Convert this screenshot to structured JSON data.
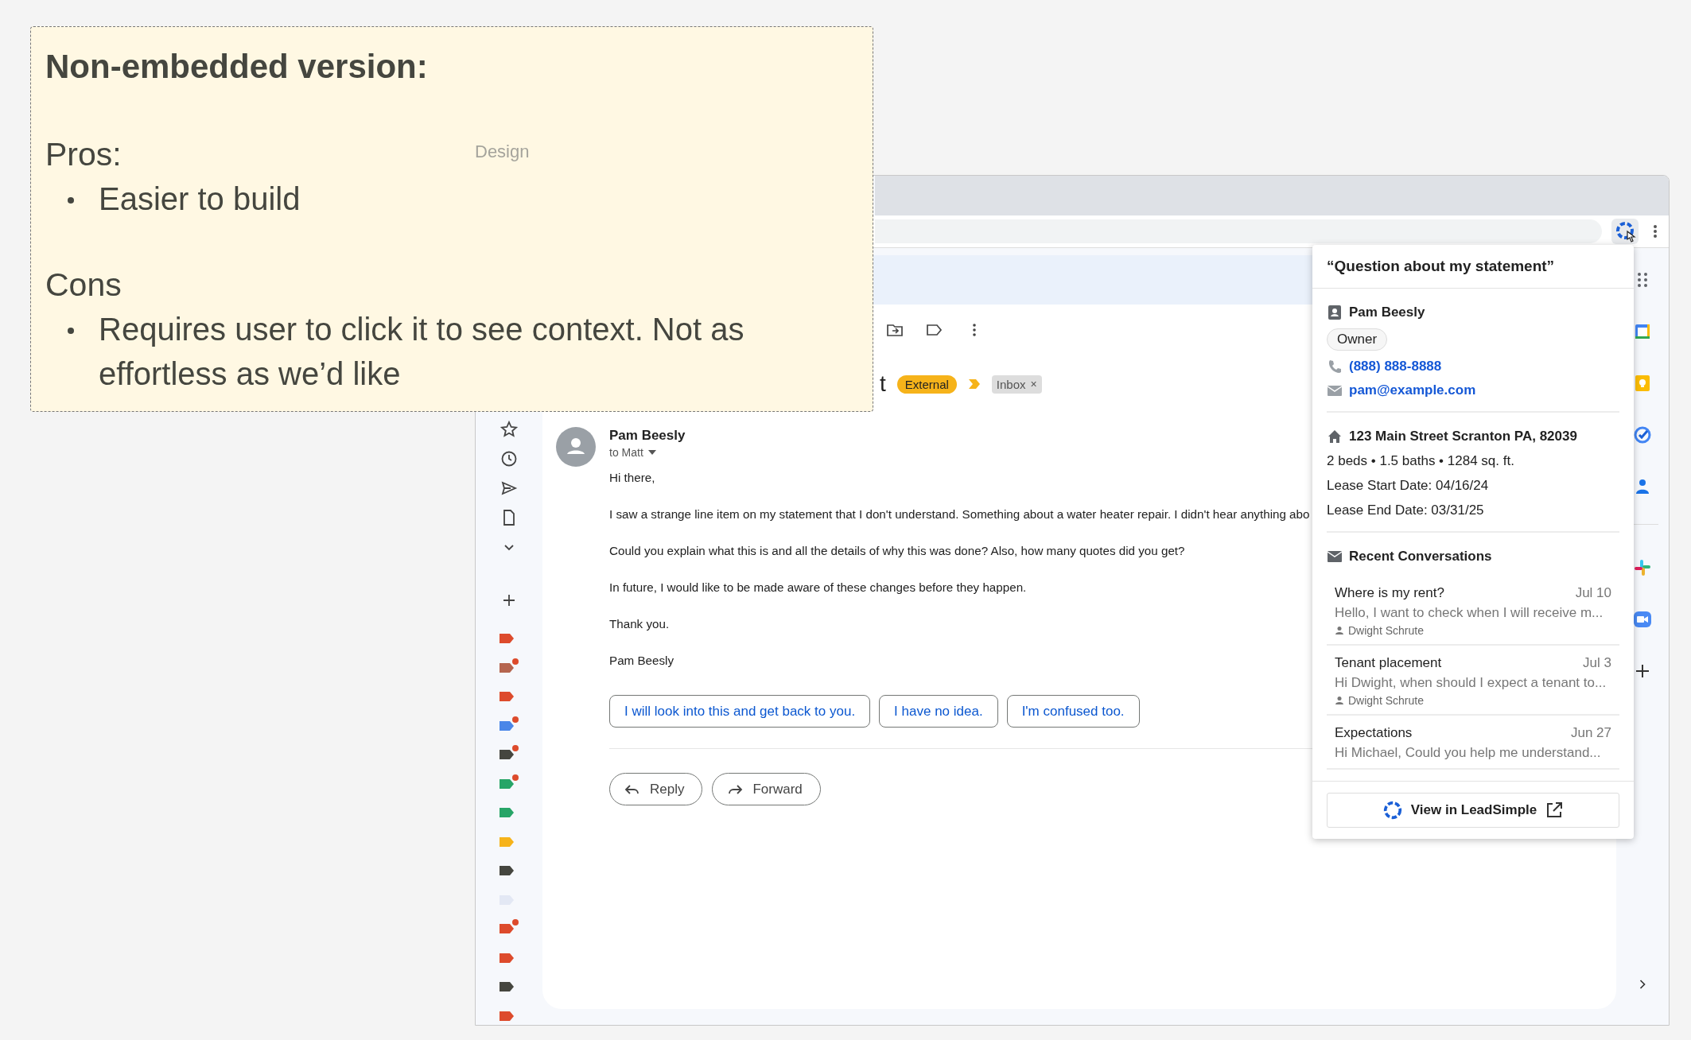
{
  "frame_label": "Design",
  "note": {
    "title": "Non-embedded version:",
    "sections": [
      {
        "heading": "Pros:",
        "items": [
          "Easier to build"
        ]
      },
      {
        "heading": "Cons",
        "items": [
          "Requires user to click it to see context. Not as effortless as we’d like"
        ]
      }
    ]
  },
  "gmail": {
    "subject_fragment": "t",
    "tags": [
      {
        "kind": "chip",
        "label": "External"
      },
      {
        "kind": "removable",
        "label": "Inbox",
        "remove": "×"
      }
    ],
    "message": {
      "sender": "Pam Beesly",
      "recipient": "to Matt",
      "body": [
        "Hi there,",
        "I saw a strange line item on my statement that I don't understand. Something about a water heater repair. I didn't hear anything abo",
        "Could you explain what this is and all the details of why this was done? Also, how many quotes did you get?",
        "In future, I would like to be made aware of these changes before they happen.",
        "Thank you.",
        "Pam Beesly"
      ],
      "smart_replies": [
        "I will look into this and get back to you.",
        "I have no idea.",
        "I'm confused too."
      ],
      "actions": [
        {
          "kind": "reply",
          "label": "Reply"
        },
        {
          "kind": "forward",
          "label": "Forward"
        }
      ]
    },
    "labels": [
      {
        "color": "#dd4b2c",
        "dot": false
      },
      {
        "color": "#b5654f",
        "dot": true
      },
      {
        "color": "#dd4b2c",
        "dot": false
      },
      {
        "color": "#4a86e8",
        "dot": true
      },
      {
        "color": "#45463f",
        "dot": true
      },
      {
        "color": "#27a567",
        "dot": true
      },
      {
        "color": "#27a567",
        "dot": false
      },
      {
        "color": "#f6b31a",
        "dot": false
      },
      {
        "color": "#45463f",
        "dot": false
      },
      {
        "color": "#e3e8f4",
        "dot": false
      },
      {
        "color": "#dd4b2c",
        "dot": true
      },
      {
        "color": "#dd4b2c",
        "dot": false
      },
      {
        "color": "#45463f",
        "dot": false
      },
      {
        "color": "#dd4b2c",
        "dot": false
      }
    ]
  },
  "extension_popup": {
    "title": "“Question about my statement”",
    "contact": {
      "name": "Pam Beesly",
      "role": "Owner",
      "phone": "(888) 888-8888",
      "email": "pam@example.com"
    },
    "property": {
      "address": "123 Main Street Scranton PA, 82039",
      "details": "2 beds • 1.5 baths • 1284 sq. ft.",
      "lease_start": "Lease Start Date: 04/16/24",
      "lease_end": "Lease End Date: 03/31/25"
    },
    "conversations_heading": "Recent Conversations",
    "conversations": [
      {
        "title": "Where is my rent?",
        "date": "Jul 10",
        "preview": "Hello, I want to check when I will receive m...",
        "author": "Dwight Schrute"
      },
      {
        "title": "Tenant placement",
        "date": "Jul 3",
        "preview": "Hi Dwight, when should I expect a tenant to...",
        "author": "Dwight Schrute"
      },
      {
        "title": "Expectations",
        "date": "Jun 27",
        "preview": "Hi Michael, Could you help me understand..."
      }
    ],
    "button": "View in LeadSimple"
  }
}
